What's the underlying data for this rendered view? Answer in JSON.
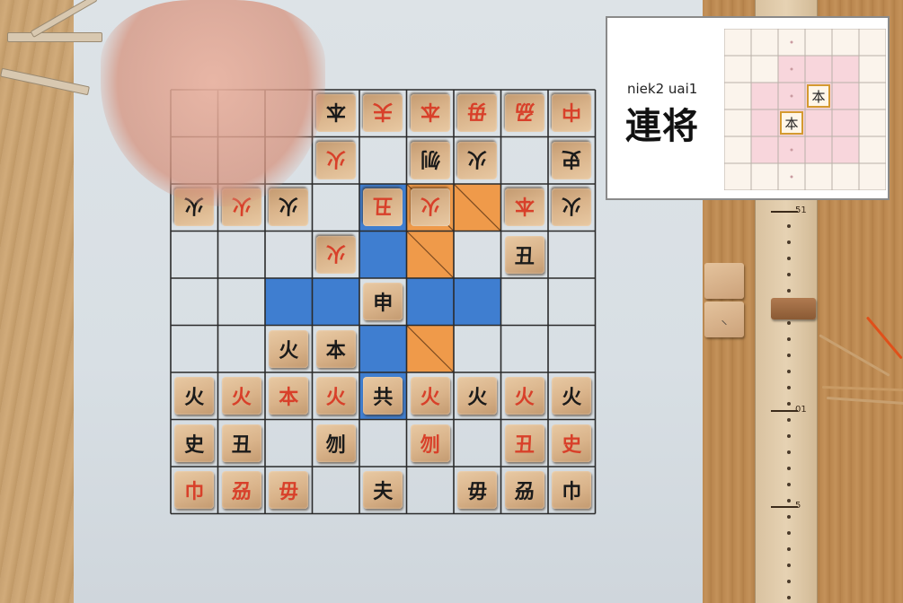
{
  "overlay": {
    "romanization": "niek2 uai1",
    "title": "連将",
    "mini_pieces": [
      {
        "label": "本",
        "col": 3,
        "row": 2
      },
      {
        "label": "本",
        "col": 2,
        "row": 3
      }
    ]
  },
  "board": {
    "cols": 9,
    "rows": 9,
    "blue_squares": [
      [
        4,
        2
      ],
      [
        4,
        3
      ],
      [
        2,
        4
      ],
      [
        3,
        4
      ],
      [
        5,
        4
      ],
      [
        6,
        4
      ],
      [
        4,
        5
      ],
      [
        4,
        6
      ]
    ],
    "orange_squares": [
      [
        5,
        2
      ],
      [
        6,
        2
      ],
      [
        5,
        3
      ],
      [
        5,
        5
      ]
    ],
    "pieces": [
      {
        "label": "本",
        "color": "black",
        "col": 3,
        "row": 0,
        "flip": true
      },
      {
        "label": "夫",
        "color": "red",
        "col": 4,
        "row": 0,
        "flip": true
      },
      {
        "label": "本",
        "color": "red",
        "col": 5,
        "row": 0,
        "flip": true
      },
      {
        "label": "毋",
        "color": "red",
        "col": 6,
        "row": 0,
        "flip": true
      },
      {
        "label": "刕",
        "color": "red",
        "col": 7,
        "row": 0,
        "flip": true
      },
      {
        "label": "中",
        "color": "red",
        "col": 8,
        "row": 0,
        "flip": true
      },
      {
        "label": "火",
        "color": "red",
        "col": 3,
        "row": 1,
        "flip": true
      },
      {
        "label": "刎",
        "color": "black",
        "col": 5,
        "row": 1,
        "flip": true
      },
      {
        "label": "火",
        "color": "black",
        "col": 6,
        "row": 1,
        "flip": true
      },
      {
        "label": "史",
        "color": "black",
        "col": 8,
        "row": 1,
        "flip": true
      },
      {
        "label": "火",
        "color": "black",
        "col": 0,
        "row": 2,
        "flip": true
      },
      {
        "label": "火",
        "color": "red",
        "col": 1,
        "row": 2,
        "flip": true
      },
      {
        "label": "火",
        "color": "black",
        "col": 2,
        "row": 2,
        "flip": true
      },
      {
        "label": "丑",
        "color": "red",
        "col": 4,
        "row": 2,
        "flip": true
      },
      {
        "label": "火",
        "color": "red",
        "col": 5,
        "row": 2,
        "flip": true
      },
      {
        "label": "本",
        "color": "red",
        "col": 7,
        "row": 2,
        "flip": true
      },
      {
        "label": "火",
        "color": "black",
        "col": 8,
        "row": 2,
        "flip": true
      },
      {
        "label": "火",
        "color": "red",
        "col": 3,
        "row": 3,
        "flip": true
      },
      {
        "label": "丑",
        "color": "black",
        "col": 7,
        "row": 3,
        "flip": false
      },
      {
        "label": "申",
        "color": "black",
        "col": 4,
        "row": 4,
        "flip": false
      },
      {
        "label": "火",
        "color": "black",
        "col": 2,
        "row": 5,
        "flip": false
      },
      {
        "label": "本",
        "color": "black",
        "col": 3,
        "row": 5,
        "flip": false
      },
      {
        "label": "火",
        "color": "black",
        "col": 0,
        "row": 6,
        "flip": false
      },
      {
        "label": "火",
        "color": "red",
        "col": 1,
        "row": 6,
        "flip": false
      },
      {
        "label": "本",
        "color": "red",
        "col": 2,
        "row": 6,
        "flip": false
      },
      {
        "label": "火",
        "color": "red",
        "col": 3,
        "row": 6,
        "flip": false
      },
      {
        "label": "共",
        "color": "black",
        "col": 4,
        "row": 6,
        "flip": false
      },
      {
        "label": "火",
        "color": "red",
        "col": 5,
        "row": 6,
        "flip": false
      },
      {
        "label": "火",
        "color": "black",
        "col": 6,
        "row": 6,
        "flip": false
      },
      {
        "label": "火",
        "color": "red",
        "col": 7,
        "row": 6,
        "flip": false
      },
      {
        "label": "火",
        "color": "black",
        "col": 8,
        "row": 6,
        "flip": false
      },
      {
        "label": "史",
        "color": "black",
        "col": 0,
        "row": 7,
        "flip": false
      },
      {
        "label": "丑",
        "color": "black",
        "col": 1,
        "row": 7,
        "flip": false
      },
      {
        "label": "刎",
        "color": "black",
        "col": 3,
        "row": 7,
        "flip": false
      },
      {
        "label": "刎",
        "color": "red",
        "col": 5,
        "row": 7,
        "flip": false
      },
      {
        "label": "丑",
        "color": "red",
        "col": 7,
        "row": 7,
        "flip": false
      },
      {
        "label": "史",
        "color": "red",
        "col": 8,
        "row": 7,
        "flip": false
      },
      {
        "label": "巾",
        "color": "red",
        "col": 0,
        "row": 8,
        "flip": false
      },
      {
        "label": "刕",
        "color": "red",
        "col": 1,
        "row": 8,
        "flip": false
      },
      {
        "label": "毋",
        "color": "red",
        "col": 2,
        "row": 8,
        "flip": false
      },
      {
        "label": "夫",
        "color": "black",
        "col": 4,
        "row": 8,
        "flip": false
      },
      {
        "label": "毋",
        "color": "black",
        "col": 6,
        "row": 8,
        "flip": false
      },
      {
        "label": "刕",
        "color": "black",
        "col": 7,
        "row": 8,
        "flip": false
      },
      {
        "label": "巾",
        "color": "black",
        "col": 8,
        "row": 8,
        "flip": false
      }
    ]
  },
  "ruler": {
    "labels": [
      {
        "text": "51",
        "pos": 0.35
      },
      {
        "text": "01",
        "pos": 0.68
      },
      {
        "text": "5",
        "pos": 0.84
      }
    ]
  },
  "colors": {
    "blue": "#3f7ed0",
    "orange": "#ef9a4a",
    "red_ink": "#d8402a",
    "black_ink": "#1a1a1a",
    "mini_pink": "#f8d6dc",
    "mini_highlight": "#d49a30"
  }
}
